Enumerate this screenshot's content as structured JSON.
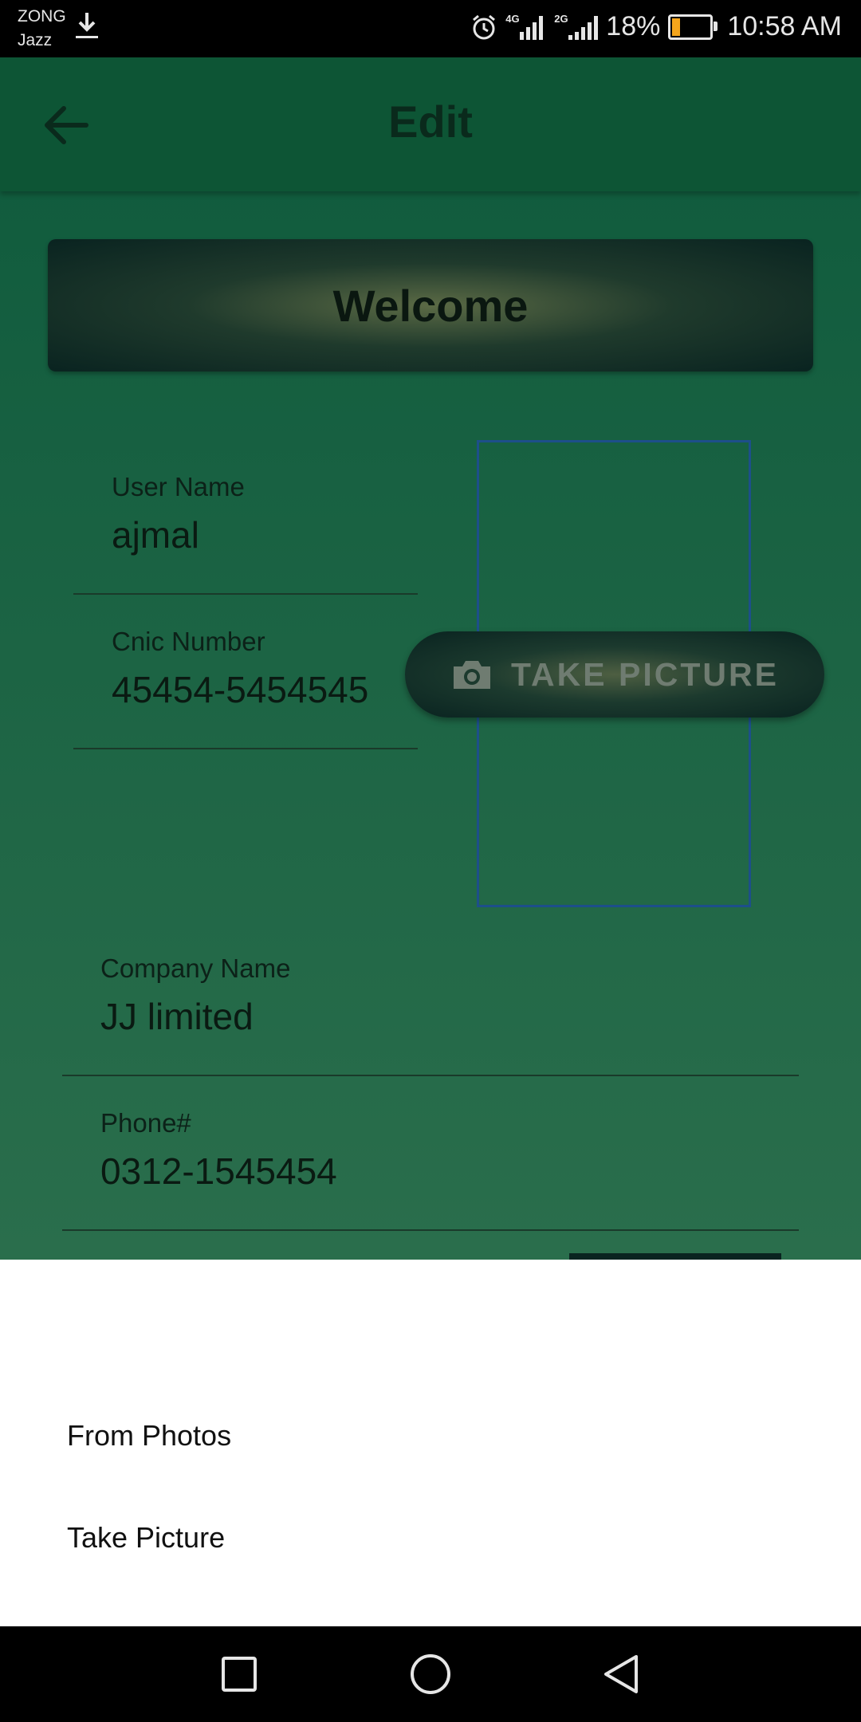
{
  "status_bar": {
    "carrier_1": "ZONG",
    "carrier_2": "Jazz",
    "signal_1_label": "4G",
    "signal_2_label": "2G",
    "battery": "18%",
    "time": "10:58 AM",
    "battery_color": "#f4a51c"
  },
  "app_bar": {
    "title": "Edit",
    "back_icon": "arrow-left-icon"
  },
  "welcome_banner": {
    "text": "Welcome"
  },
  "form": {
    "user_name": {
      "label": "User Name",
      "value": "ajmal"
    },
    "cnic": {
      "label": "Cnic Number",
      "value": "45454-5454545"
    },
    "company": {
      "label": "Company Name",
      "value": "JJ limited"
    },
    "phone": {
      "label": "Phone#",
      "value": "0312-1545454"
    }
  },
  "take_picture_button": {
    "label": "TAKE PICTURE",
    "icon": "camera-icon"
  },
  "bottom_sheet": {
    "items": [
      {
        "label": "From Photos"
      },
      {
        "label": "Take Picture"
      }
    ]
  },
  "nav_bar": {
    "icons": [
      "recents-square-icon",
      "home-circle-icon",
      "back-triangle-icon"
    ]
  }
}
